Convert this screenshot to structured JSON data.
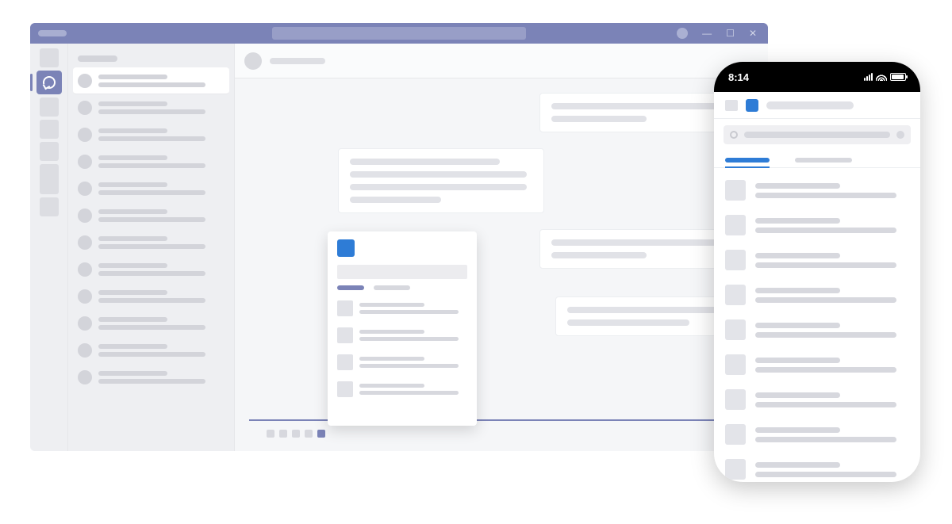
{
  "colors": {
    "accent": "#7b83b7",
    "appBlue": "#2e7cd6",
    "placeholder": "#d7d8de"
  },
  "desktop": {
    "titlebar": {
      "appName": "",
      "searchPlaceholder": ""
    },
    "rail": {
      "items": [
        {
          "name": "activity",
          "active": false
        },
        {
          "name": "chat",
          "active": true
        },
        {
          "name": "teams",
          "active": false
        },
        {
          "name": "calendar",
          "active": false
        },
        {
          "name": "calls",
          "active": false
        },
        {
          "name": "files",
          "active": false
        },
        {
          "name": "apps",
          "active": false
        }
      ]
    },
    "chatList": {
      "header": "",
      "items": [
        {
          "selected": true
        },
        {
          "selected": false
        },
        {
          "selected": false
        },
        {
          "selected": false
        },
        {
          "selected": false
        },
        {
          "selected": false
        },
        {
          "selected": false
        },
        {
          "selected": false
        },
        {
          "selected": false
        },
        {
          "selected": false
        },
        {
          "selected": false
        },
        {
          "selected": false
        }
      ]
    },
    "conversation": {
      "participantName": "",
      "messages": [
        {
          "side": "right",
          "lines": 2
        },
        {
          "side": "left",
          "lines": 4
        },
        {
          "side": "right",
          "lines": 2
        },
        {
          "side": "right",
          "lines": 2
        }
      ],
      "compose": {
        "extensions": [
          {
            "active": false
          },
          {
            "active": false
          },
          {
            "active": false
          },
          {
            "active": false
          },
          {
            "active": true
          }
        ]
      }
    },
    "extensionPopup": {
      "searchPlaceholder": "",
      "tabs": [
        {
          "active": true
        },
        {
          "active": false
        }
      ],
      "results": [
        {},
        {},
        {},
        {}
      ]
    }
  },
  "phone": {
    "statusbar": {
      "time": "8:14"
    },
    "header": {
      "title": ""
    },
    "search": {
      "placeholder": ""
    },
    "tabs": [
      {
        "active": true
      },
      {
        "active": false
      }
    ],
    "list": [
      {},
      {},
      {},
      {},
      {},
      {},
      {},
      {},
      {}
    ]
  }
}
